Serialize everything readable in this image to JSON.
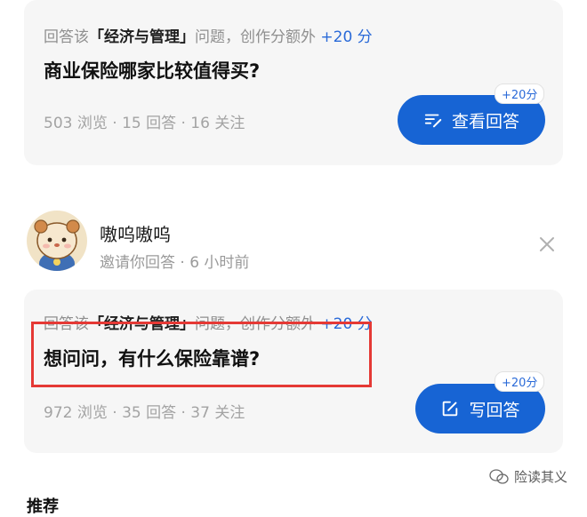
{
  "cards": [
    {
      "meta_prefix": "回答该",
      "meta_topic": "「经济与管理」",
      "meta_suffix": "问题，创作分额外",
      "meta_points": "+20 分",
      "question": "商业保险哪家比较值得买?",
      "stats": "503 浏览 · 15 回答 · 16 关注",
      "button_label": "查看回答",
      "button_icon": "edit-list-icon",
      "badge": "+20分"
    },
    {
      "meta_prefix": "回答该",
      "meta_topic": "「经济与管理」",
      "meta_suffix": "问题，创作分额外",
      "meta_points": "+20 分",
      "question": "想问问，有什么保险靠谱?",
      "stats": "972 浏览 · 35 回答 · 37 关注",
      "button_label": "写回答",
      "button_icon": "edit-square-icon",
      "badge": "+20分"
    }
  ],
  "invite": {
    "username": "嗷呜嗷呜",
    "subtitle": "邀请你回答 · 6 小时前",
    "close_icon": "close-icon"
  },
  "watermark": "险读其义",
  "next_section_title": "推荐",
  "colors": {
    "accent": "#1764d4",
    "highlight_box": "#e53935",
    "card_bg": "#f6f6f6"
  }
}
